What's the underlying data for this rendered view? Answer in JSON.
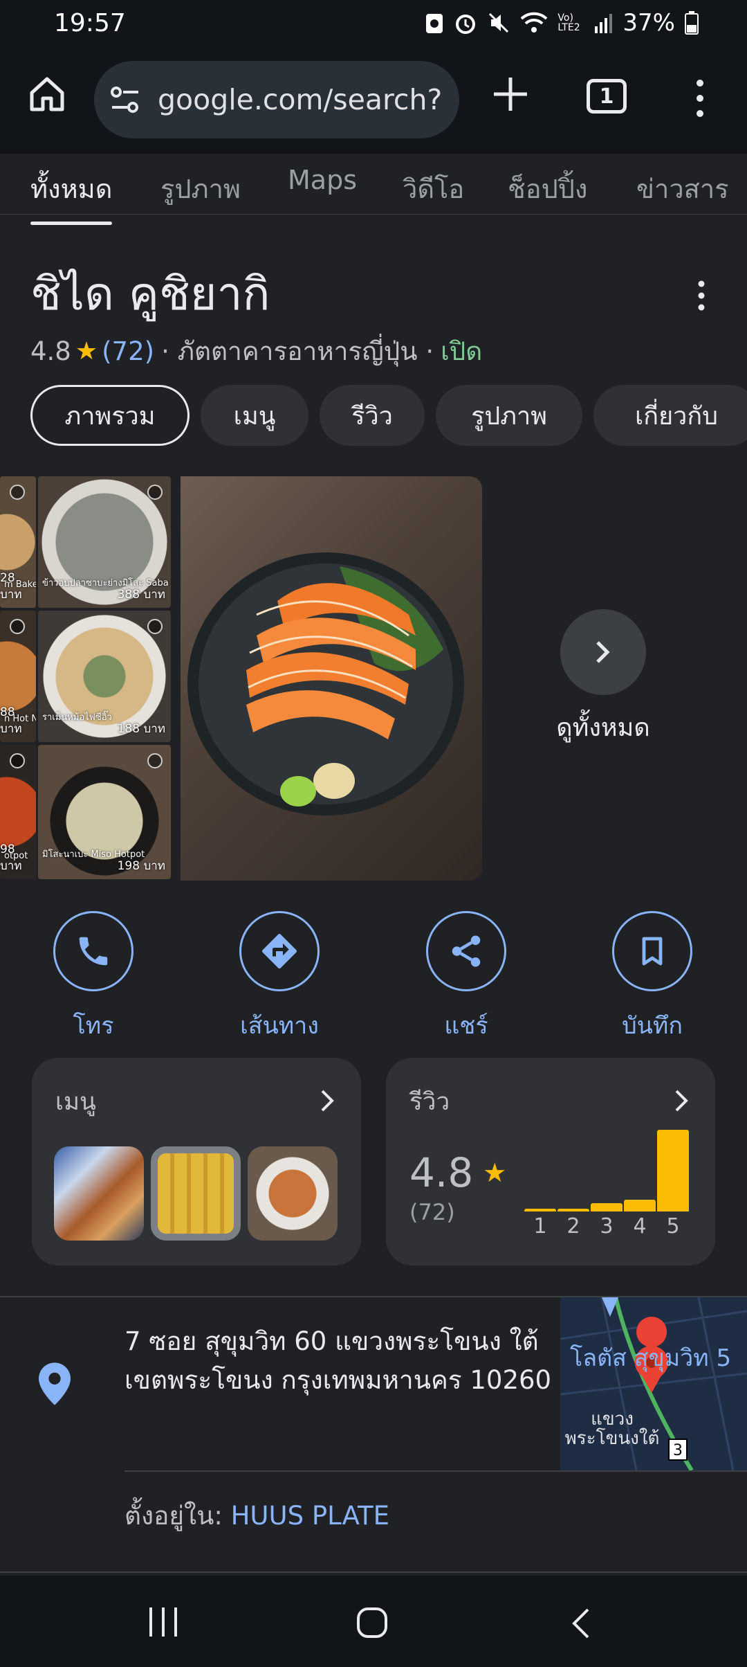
{
  "status_bar": {
    "time": "19:57",
    "battery": "37%",
    "network": "Vo) LTE2"
  },
  "browser": {
    "url": "google.com/search?",
    "tab_count": "1"
  },
  "search_tabs": [
    "ทั้งหมด",
    "รูปภาพ",
    "Maps",
    "วิดีโอ",
    "ช็อปปิ้ง",
    "ข่าวสาร"
  ],
  "place": {
    "name": "ชิได คูชิยากิ",
    "rating": "4.8",
    "review_count": "(72)",
    "category": "· ภัตตาคารอาหารญี่ปุ่น ·",
    "status": "เปิด"
  },
  "chips": [
    "ภาพรวม",
    "เมนู",
    "รีวิว",
    "รูปภาพ",
    "เกี่ยวกับ"
  ],
  "photos": {
    "thumbs": [
      {
        "caption": "m Bake",
        "price": "28 บาท"
      },
      {
        "caption": "ข้าวอบปลาซาบะย่างมิโสะ Saba C",
        "price": "388 บาท"
      },
      {
        "caption": "n Hot N",
        "price": "88 บาท"
      },
      {
        "caption": "ราเม็นหม้อไฟซีอิ๊ว",
        "price": "188 บาท"
      },
      {
        "caption": "otpot",
        "price": "98 บาท"
      },
      {
        "caption": "มิโสะนาเบะ Miso Hotpot",
        "price": "198 บาท"
      }
    ],
    "see_all": "ดูทั้งหมด"
  },
  "actions": [
    {
      "label": "โทร",
      "icon": "phone-icon"
    },
    {
      "label": "เส้นทาง",
      "icon": "directions-icon"
    },
    {
      "label": "แชร์",
      "icon": "share-icon"
    },
    {
      "label": "บันทึก",
      "icon": "bookmark-icon"
    }
  ],
  "menu_card": {
    "title": "เมนู"
  },
  "review_card": {
    "title": "รีวิว",
    "rating": "4.8",
    "count": "(72)",
    "distribution": [
      {
        "stars": "1",
        "fraction": 0.03
      },
      {
        "stars": "2",
        "fraction": 0.03
      },
      {
        "stars": "3",
        "fraction": 0.1
      },
      {
        "stars": "4",
        "fraction": 0.14
      },
      {
        "stars": "5",
        "fraction": 1.0
      }
    ]
  },
  "address": {
    "text": "7 ซอย สุขุมวิท 60 แขวงพระโขนง ใต้ เขตพระโขนง กรุงเทพมหานคร 10260",
    "located_in_label": "ตั้งอยู่ใน:",
    "located_in_value": "HUUS PLATE"
  },
  "map": {
    "label_road": "โลตัส สุขุมวิท 5",
    "label_area": "แขวง พระโขนงใต้",
    "route_number": "3"
  },
  "colors": {
    "accent_blue": "#8ab4f8",
    "star": "#fbbc04",
    "open_green": "#81c995",
    "background": "#202124"
  }
}
